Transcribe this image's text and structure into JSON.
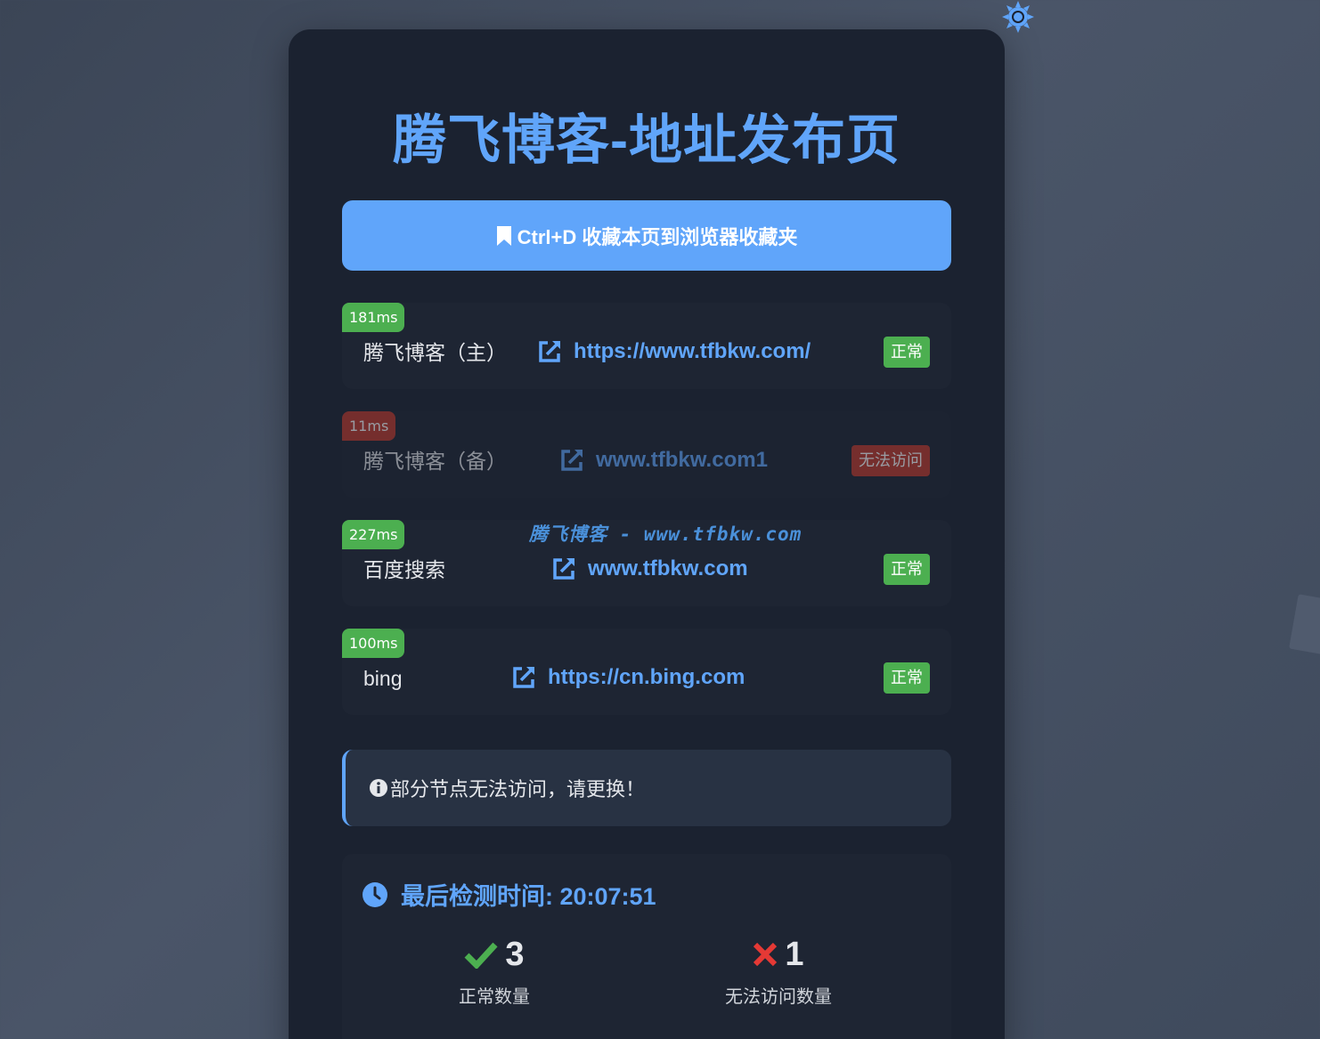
{
  "title": "腾飞博客-地址发布页",
  "bookmark": {
    "label": "Ctrl+D 收藏本页到浏览器收藏夹",
    "icon": "bookmark-icon"
  },
  "watermark": "腾飞博客 - www.tfbkw.com",
  "sites": [
    {
      "latency": "181ms",
      "name": "腾飞博客（主）",
      "url": "https://www.tfbkw.com/",
      "status": "正常",
      "ok": true
    },
    {
      "latency": "11ms",
      "name": "腾飞博客（备）",
      "url": "www.tfbkw.com1",
      "status": "无法访问",
      "ok": false
    },
    {
      "latency": "227ms",
      "name": "百度搜索",
      "url": "www.tfbkw.com",
      "status": "正常",
      "ok": true
    },
    {
      "latency": "100ms",
      "name": "bing",
      "url": "https://cn.bing.com",
      "status": "正常",
      "ok": true
    }
  ],
  "notice": {
    "icon": "info-icon",
    "text": "部分节点无法访问，请更换！"
  },
  "stats": {
    "check_time": "最后检测时间: 20:07:51",
    "ok_count": "3",
    "ok_label": "正常数量",
    "bad_count": "1",
    "bad_label": "无法访问数量"
  },
  "colors": {
    "accent": "#60a5fa",
    "ok": "#4caf50",
    "bad": "#c0392b",
    "card": "#1b2230"
  }
}
